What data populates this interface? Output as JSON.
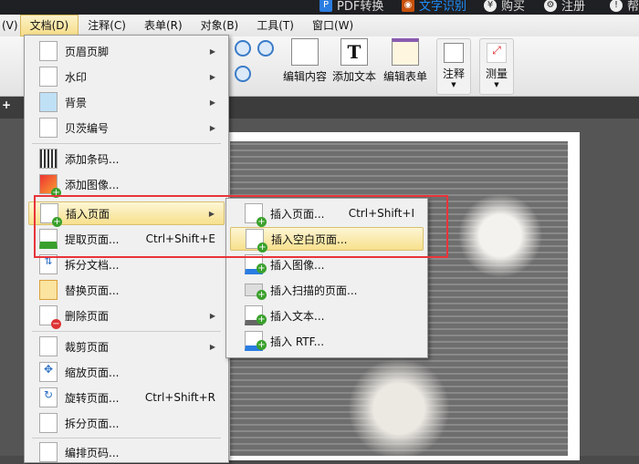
{
  "topbar": {
    "items": [
      {
        "label": "PDF转换",
        "icon": "pdf-convert-icon"
      },
      {
        "label": "文字识别",
        "icon": "ocr-eye-icon",
        "color": "#1e90ff"
      },
      {
        "label": "购买",
        "icon": "cart-icon"
      },
      {
        "label": "注册",
        "icon": "register-icon"
      },
      {
        "label": "帮",
        "icon": "help-icon"
      }
    ]
  },
  "menubar": [
    "(V)",
    "文档(D)",
    "注释(C)",
    "表单(R)",
    "对象(B)",
    "工具(T)",
    "窗口(W)"
  ],
  "toolbar": {
    "edit_content": "编辑内容",
    "add_text": "添加文本",
    "edit_form": "编辑表单",
    "annotate": "注释",
    "measure": "测量"
  },
  "main_menu": [
    {
      "label": "页眉页脚",
      "submenu": true
    },
    {
      "label": "水印",
      "submenu": true
    },
    {
      "label": "背景",
      "submenu": true
    },
    {
      "label": "贝茨编号",
      "submenu": true
    },
    {
      "label": "添加条码..."
    },
    {
      "label": "添加图像..."
    },
    {
      "label": "插入页面",
      "submenu": true,
      "highlighted": true
    },
    {
      "label": "提取页面...",
      "shortcut": "Ctrl+Shift+E"
    },
    {
      "label": "拆分文档..."
    },
    {
      "label": "替换页面..."
    },
    {
      "label": "删除页面",
      "submenu": true
    },
    {
      "label": "裁剪页面",
      "submenu": true
    },
    {
      "label": "缩放页面..."
    },
    {
      "label": "旋转页面...",
      "shortcut": "Ctrl+Shift+R"
    },
    {
      "label": "拆分页面..."
    },
    {
      "label": "编排页码..."
    }
  ],
  "submenu": [
    {
      "label": "插入页面...",
      "shortcut": "Ctrl+Shift+I"
    },
    {
      "label": "插入空白页面...",
      "highlighted": true
    },
    {
      "label": "插入图像..."
    },
    {
      "label": "插入扫描的页面..."
    },
    {
      "label": "插入文本..."
    },
    {
      "label": "插入 RTF..."
    }
  ],
  "colors": {
    "highlight": "#f7e08c",
    "annotation_box": "#e8343a"
  }
}
